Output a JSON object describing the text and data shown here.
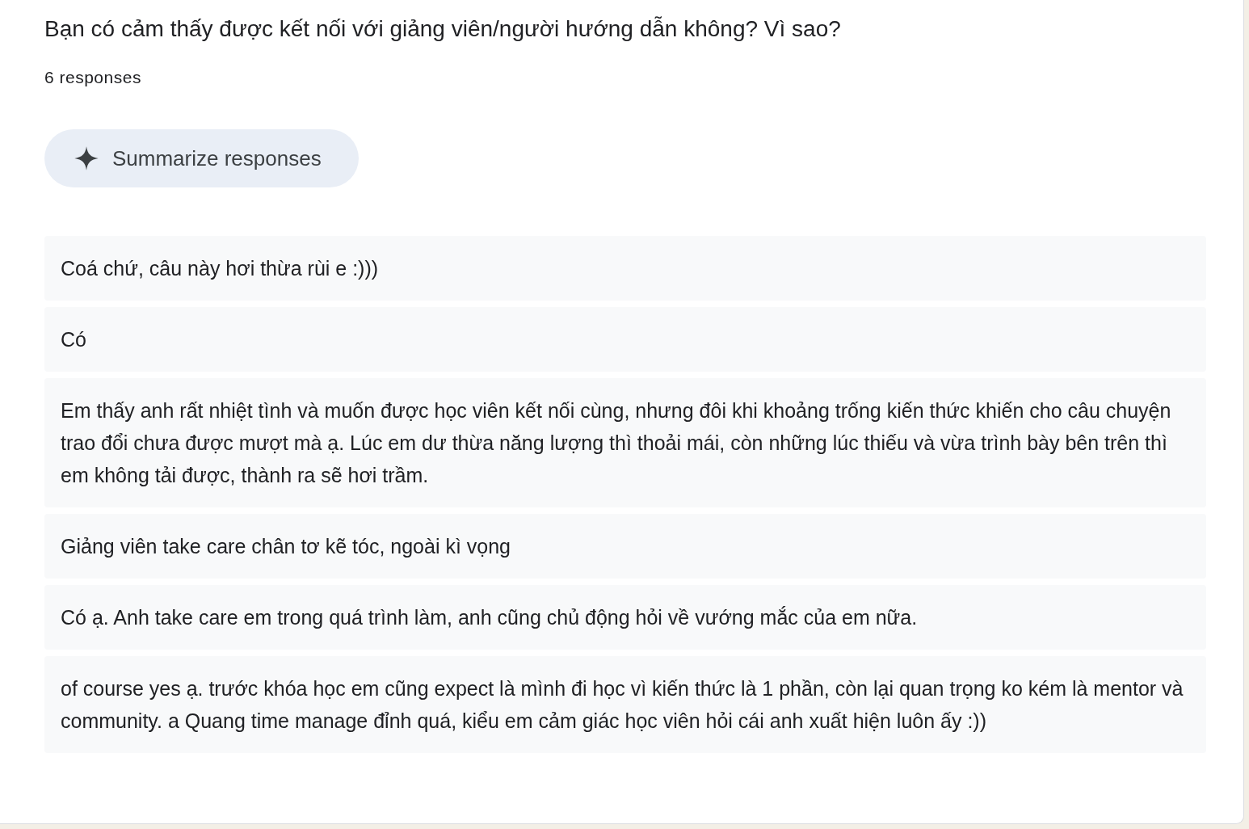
{
  "question": {
    "title": "Bạn có cảm thấy được kết nối với giảng viên/người hướng dẫn không? Vì sao?",
    "count": "6 responses"
  },
  "summarize_button": {
    "label": "Summarize responses"
  },
  "responses": [
    {
      "text": "Coá chứ, câu này hơi thừa rùi e :)))"
    },
    {
      "text": "Có"
    },
    {
      "text": "Em thấy anh rất nhiệt tình và muốn được học viên kết nối cùng, nhưng đôi khi khoảng trống kiến thức khiến cho câu chuyện trao đổi chưa được mượt mà ạ. Lúc em dư thừa năng lượng thì thoải mái, còn những lúc thiếu và vừa trình bày bên trên thì em không tải được, thành ra sẽ hơi trầm."
    },
    {
      "text": "Giảng viên take care chân tơ kẽ tóc, ngoài kì vọng"
    },
    {
      "text": "Có ạ. Anh take care em trong quá trình làm, anh cũng chủ động hỏi về vướng mắc của em nữa."
    },
    {
      "text": "of course yes ạ. trước khóa học em cũng expect là mình đi học vì kiến thức là 1 phần, còn lại quan trọng ko kém là mentor và community. a Quang time manage đỉnh quá, kiểu em cảm giác học viên hỏi cái anh xuất hiện luôn ấy :))"
    }
  ]
}
